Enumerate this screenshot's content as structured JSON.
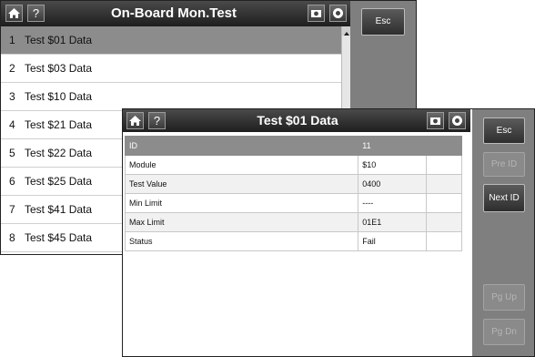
{
  "back_window": {
    "title": "On-Board Mon.Test",
    "icons": [
      "home-icon",
      "help-icon",
      "camera-icon",
      "record-icon"
    ],
    "esc_label": "Esc",
    "items": [
      {
        "num": "1",
        "label": "Test $01 Data"
      },
      {
        "num": "2",
        "label": "Test $03 Data"
      },
      {
        "num": "3",
        "label": "Test $10 Data"
      },
      {
        "num": "4",
        "label": "Test $21 Data"
      },
      {
        "num": "5",
        "label": "Test $22 Data"
      },
      {
        "num": "6",
        "label": "Test $25 Data"
      },
      {
        "num": "7",
        "label": "Test $41 Data"
      },
      {
        "num": "8",
        "label": "Test $45 Data"
      }
    ]
  },
  "front_window": {
    "title": "Test $01 Data",
    "help_glyph": "?",
    "table": {
      "rows": [
        {
          "name": "ID",
          "value": "11",
          "extra": ""
        },
        {
          "name": "Module",
          "value": "$10",
          "extra": ""
        },
        {
          "name": "Test Value",
          "value": "0400",
          "extra": ""
        },
        {
          "name": "Min Limit",
          "value": "----",
          "extra": ""
        },
        {
          "name": "Max Limit",
          "value": "01E1",
          "extra": ""
        },
        {
          "name": "Status",
          "value": "Fail",
          "extra": ""
        }
      ]
    },
    "buttons": {
      "esc": "Esc",
      "prev_id": "Pre ID",
      "next_id": "Next ID",
      "pg_up": "Pg Up",
      "pg_dn": "Pg Dn"
    }
  },
  "colors": {
    "titlebar": "#2b2b2b",
    "side_panel": "#7f7f7f",
    "selected_row": "#8c8c8c"
  }
}
